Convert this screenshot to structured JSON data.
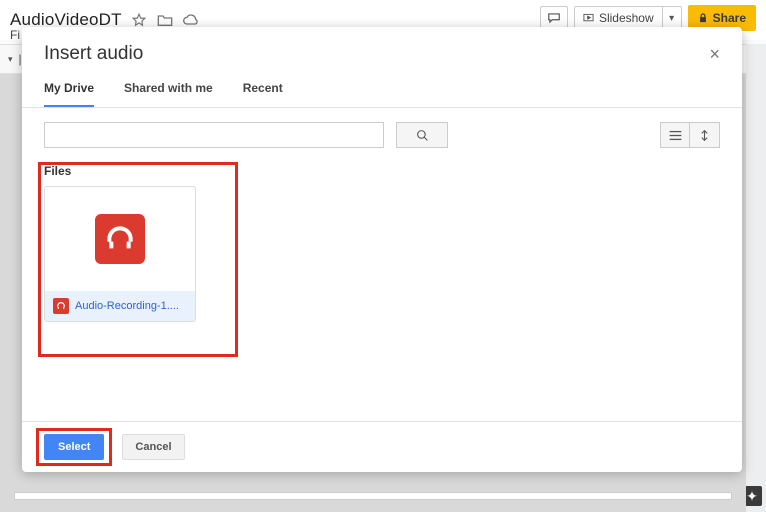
{
  "topbar": {
    "doc_title": "AudioVideoDT",
    "slideshow_label": "Slideshow",
    "share_label": "Share"
  },
  "menubar": {
    "file_label": "Fi"
  },
  "dialog": {
    "title": "Insert audio",
    "tabs": {
      "my_drive": "My Drive",
      "shared": "Shared with me",
      "recent": "Recent"
    },
    "section_files": "Files",
    "file": {
      "name": "Audio-Recording-1...."
    },
    "select_label": "Select",
    "cancel_label": "Cancel"
  }
}
